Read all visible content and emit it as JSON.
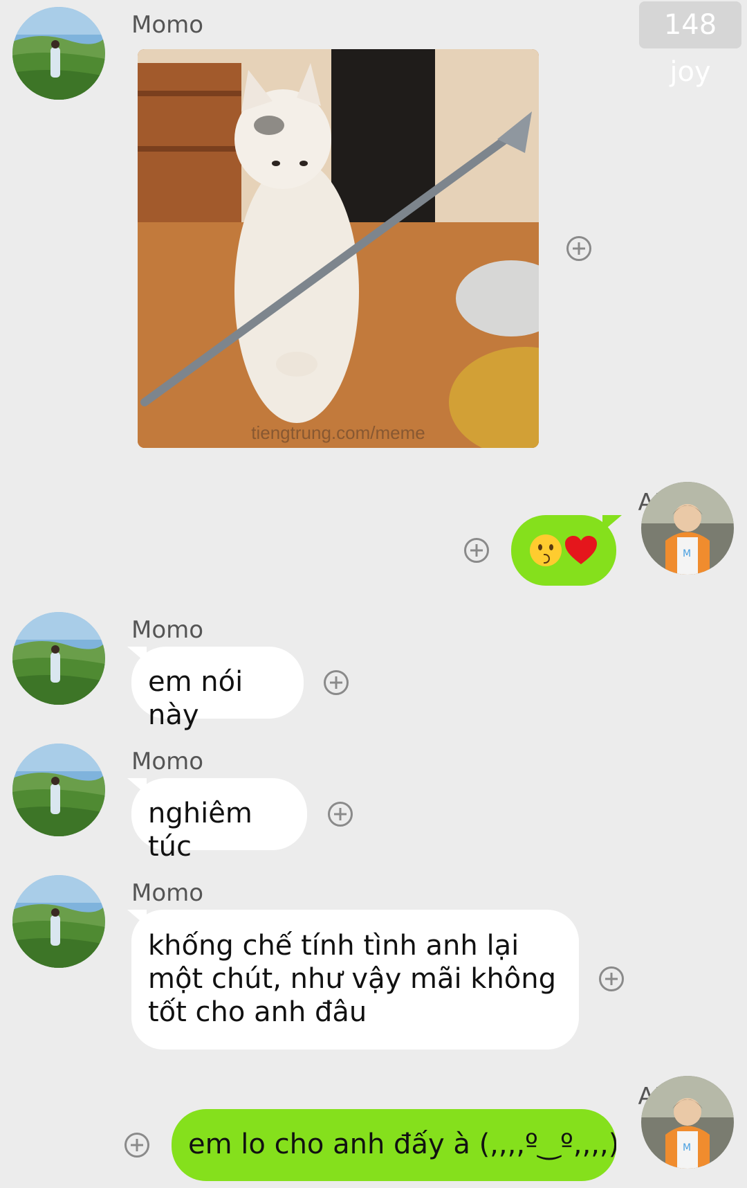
{
  "status_badge": "148 joy",
  "messages": [
    {
      "sender": "Momo",
      "type": "image",
      "watermark": "tiengtrung.com/meme"
    },
    {
      "sender": "AK",
      "type": "emoji",
      "emoji": [
        "kissing-face",
        "red-heart"
      ]
    },
    {
      "sender": "Momo",
      "type": "text",
      "text": "em nói này"
    },
    {
      "sender": "Momo",
      "type": "text",
      "text": "nghiêm túc"
    },
    {
      "sender": "Momo",
      "type": "text",
      "text": "khống chế tính tình anh lại một chút, như vậy mãi không tốt cho anh đâu"
    },
    {
      "sender": "AK",
      "type": "text",
      "text": "em lo cho anh đấy à (,,,,º‿º,,,,)♡"
    }
  ],
  "colors": {
    "background": "#ececec",
    "outgoing_bubble": "#85e01c",
    "incoming_bubble": "#ffffff",
    "badge_background": "#d6d6d6"
  },
  "icons": {
    "add": "plus-circle-icon"
  }
}
